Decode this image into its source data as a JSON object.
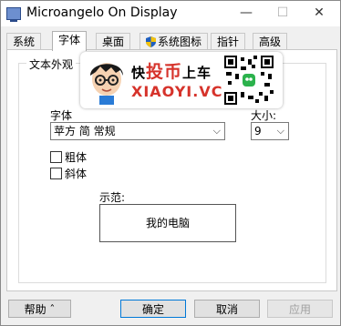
{
  "window": {
    "title": "Microangelo On Display",
    "minimize": "—",
    "maximize": "☐",
    "close": "✕"
  },
  "tabs": [
    {
      "label": "系统",
      "active": false
    },
    {
      "label": "字体",
      "active": true
    },
    {
      "label": "桌面",
      "active": false
    },
    {
      "label": "系统图标",
      "active": false,
      "icon": "shield-icon"
    },
    {
      "label": "指针",
      "active": false
    },
    {
      "label": "高级",
      "active": false
    }
  ],
  "group": {
    "legend": "文本外观"
  },
  "font": {
    "label": "字体",
    "value": "苹方 简 常规"
  },
  "size": {
    "label": "大小:",
    "value": "9"
  },
  "options": {
    "bold_label": "粗体",
    "italic_label": "斜体"
  },
  "sample": {
    "label": "示范:",
    "text": "我的电脑"
  },
  "watermark": {
    "line1_a": "快",
    "line1_b": "投币",
    "line1_c": "上车",
    "line2": "XIAOYI.VC"
  },
  "buttons": {
    "help": "帮助 ˆ",
    "ok": "确定",
    "cancel": "取消",
    "apply": "应用"
  },
  "colors": {
    "accent": "#0078d7",
    "watermark_red": "#d6332b"
  }
}
